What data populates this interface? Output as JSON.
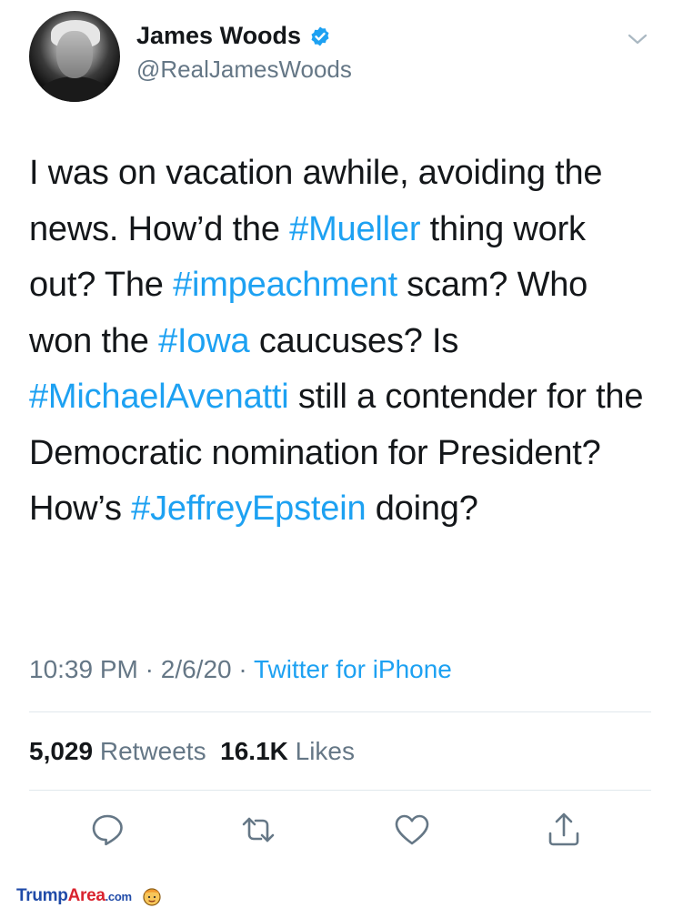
{
  "user": {
    "name": "James Woods",
    "handle": "@RealJamesWoods",
    "verified": true
  },
  "tweet": {
    "segments": [
      {
        "text": "I was on vacation awhile, avoiding the news. How’d the ",
        "hashtag": false
      },
      {
        "text": "#Mueller",
        "hashtag": true
      },
      {
        "text": " thing work out? The ",
        "hashtag": false
      },
      {
        "text": "#impeachment",
        "hashtag": true
      },
      {
        "text": " scam? Who won the ",
        "hashtag": false
      },
      {
        "text": "#Iowa",
        "hashtag": true
      },
      {
        "text": " caucuses? Is ",
        "hashtag": false
      },
      {
        "text": "#MichaelAvenatti",
        "hashtag": true
      },
      {
        "text": " still a contender for the Democratic nomination for President? How’s ",
        "hashtag": false
      },
      {
        "text": "#JeffreyEpstein",
        "hashtag": true
      },
      {
        "text": " doing?",
        "hashtag": false
      }
    ]
  },
  "meta": {
    "time": "10:39 PM",
    "separator": " · ",
    "date": "2/6/20",
    "source": "Twitter for iPhone"
  },
  "stats": {
    "retweets_count": "5,029",
    "retweets_label": "Retweets",
    "likes_count": "16.1K",
    "likes_label": "Likes"
  },
  "actions": [
    "reply-icon",
    "retweet-icon",
    "like-icon",
    "share-icon"
  ],
  "footer": {
    "brand_part1": "Trump",
    "brand_part2": "Area",
    "brand_part3": ".com"
  },
  "colors": {
    "link": "#1da1f2",
    "secondary": "#657786",
    "text": "#14171a",
    "divider": "#e1e8ed"
  }
}
